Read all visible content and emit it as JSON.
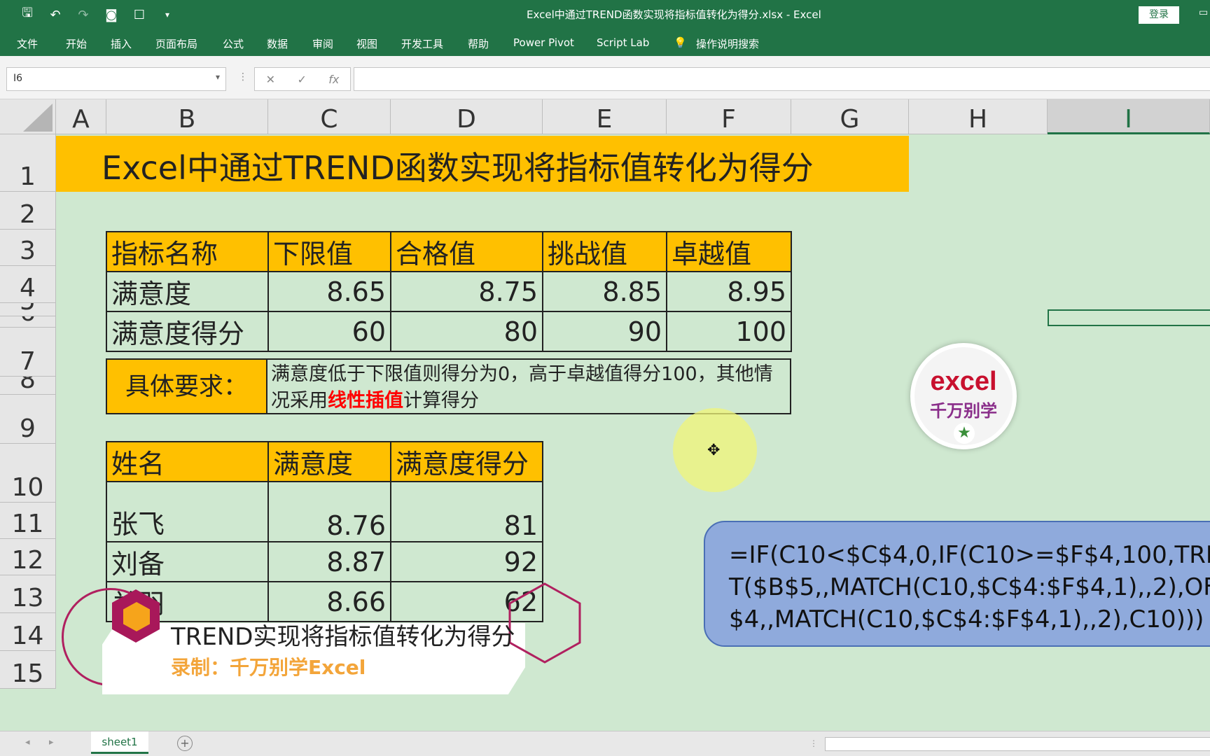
{
  "titlebar": {
    "doc_title": "Excel中通过TREND函数实现将指标值转化为得分.xlsx  -  Excel",
    "login": "登录"
  },
  "ribbon": {
    "tabs": [
      "文件",
      "开始",
      "插入",
      "页面布局",
      "公式",
      "数据",
      "审阅",
      "视图",
      "开发工具",
      "帮助",
      "Power Pivot",
      "Script Lab",
      "操作说明搜索"
    ]
  },
  "formula_bar": {
    "name_box": "I6",
    "fx": "fx",
    "formula": ""
  },
  "columns": [
    "A",
    "B",
    "C",
    "D",
    "E",
    "F",
    "G",
    "H",
    "I"
  ],
  "rows": [
    "1",
    "2",
    "3",
    "4",
    "5",
    "6",
    "7",
    "8",
    "9",
    "10",
    "11",
    "12",
    "13",
    "14",
    "15"
  ],
  "sheet": {
    "title": "Excel中通过TREND函数实现将指标值转化为得分",
    "indicator_table": {
      "headers": [
        "指标名称",
        "下限值",
        "合格值",
        "挑战值",
        "卓越值"
      ],
      "rows": [
        [
          "满意度",
          "8.65",
          "8.75",
          "8.85",
          "8.95"
        ],
        [
          "满意度得分",
          "60",
          "80",
          "90",
          "100"
        ]
      ]
    },
    "requirement": {
      "label": "具体要求：",
      "text_pre": "满意度低于下限值则得分为0，高于卓越值得分100，其他情况采用",
      "text_red": "线性插值",
      "text_post": "计算得分"
    },
    "score_table": {
      "headers": [
        "姓名",
        "满意度",
        "满意度得分"
      ],
      "rows": [
        [
          "张飞",
          "8.76",
          "81"
        ],
        [
          "刘备",
          "8.87",
          "92"
        ],
        [
          "关羽",
          "8.66",
          "62"
        ]
      ]
    }
  },
  "formula_callout": "=IF(C10<$C$4,0,IF(C10>=$F$4,100,TREND\nT($B$5,,MATCH(C10,$C$4:$F$4,1),,2),OFF\n$4,,MATCH(C10,$C$4:$F$4,1),,2),C10)))",
  "logo": {
    "line1": "excel",
    "line2": "千万别学"
  },
  "watermark": {
    "line1": "TREND实现将指标值转化为得分",
    "line2": "录制：千万别学Excel"
  },
  "sheet_tabs": [
    "sheet1"
  ]
}
